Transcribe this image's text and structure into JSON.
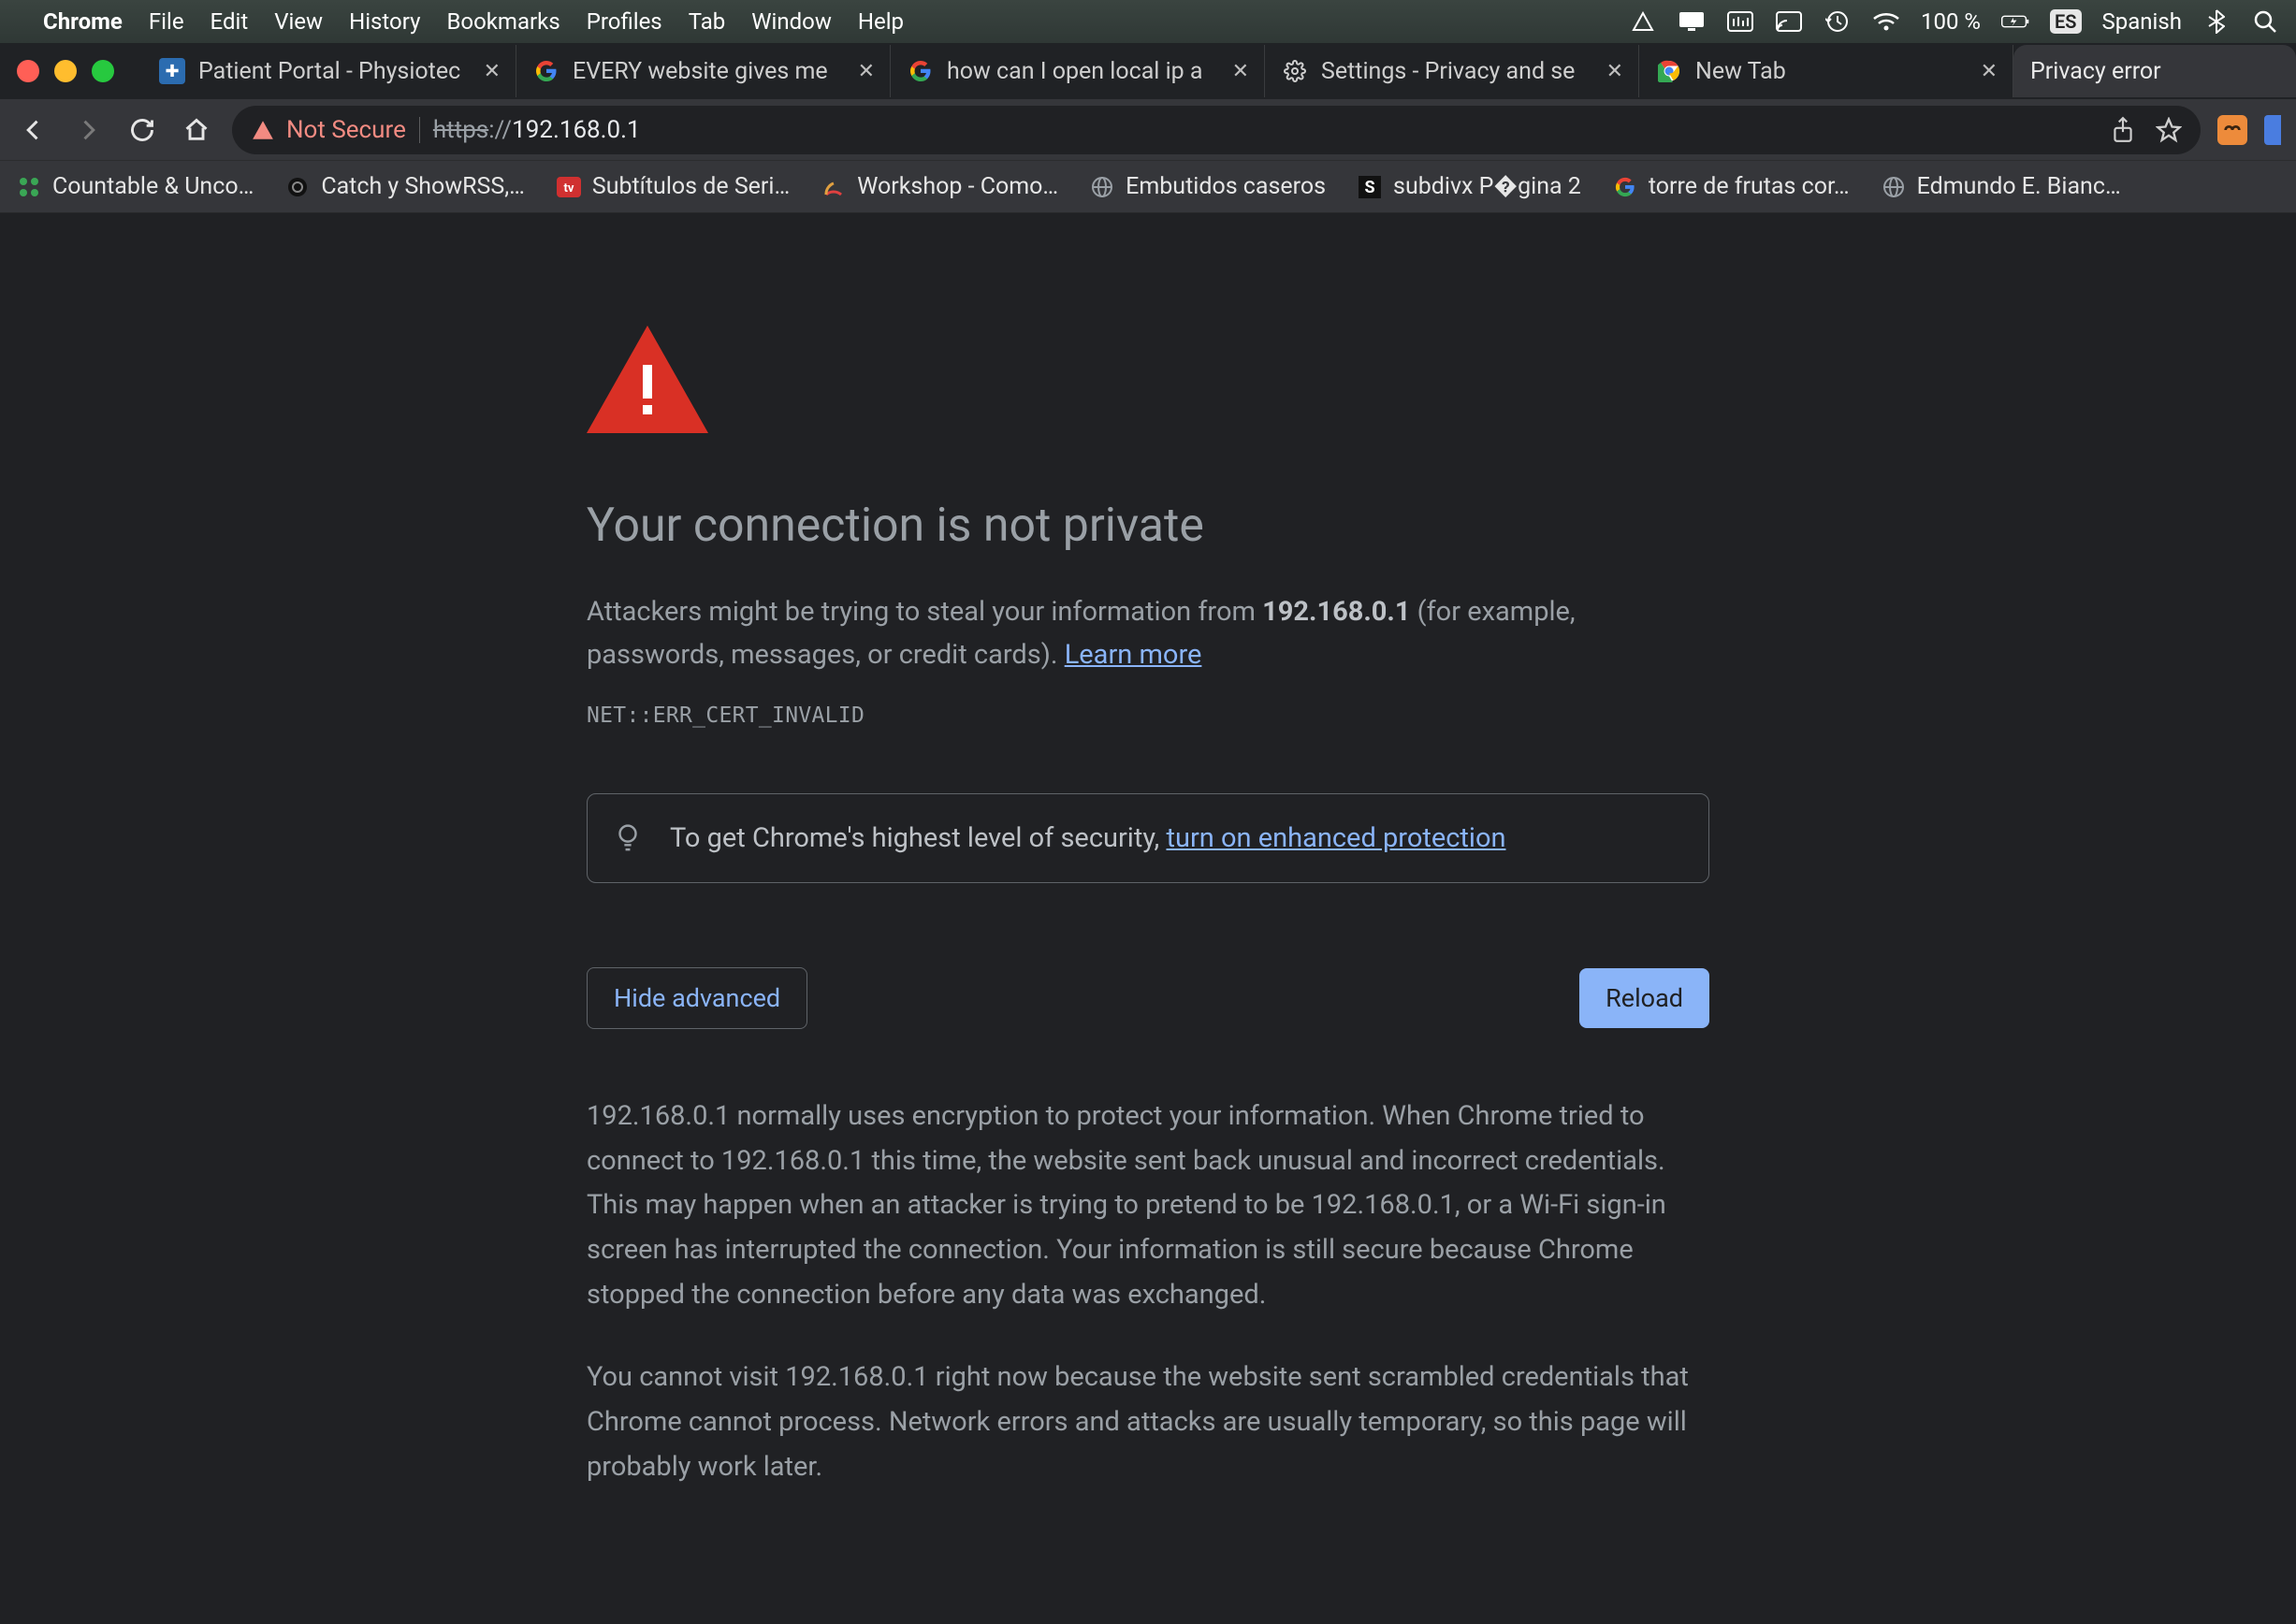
{
  "menubar": {
    "app": "Chrome",
    "items": [
      "File",
      "Edit",
      "View",
      "History",
      "Bookmarks",
      "Profiles",
      "Tab",
      "Window",
      "Help"
    ],
    "battery": "100 %",
    "lang_code": "ES",
    "lang_name": "Spanish"
  },
  "tabs": [
    {
      "title": "Patient Portal - Physiotec",
      "favicon": "physio"
    },
    {
      "title": "EVERY website gives me",
      "favicon": "google"
    },
    {
      "title": "how can I open local ip a",
      "favicon": "google"
    },
    {
      "title": "Settings - Privacy and se",
      "favicon": "gear"
    },
    {
      "title": "New Tab",
      "favicon": "chrome"
    },
    {
      "title": "Privacy error",
      "favicon": "none",
      "active": true
    }
  ],
  "omnibox": {
    "not_secure": "Not Secure",
    "scheme": "https",
    "colon": "://",
    "host": "192.168.0.1"
  },
  "bookmarks": [
    {
      "title": "Countable & Unco…",
      "icon": "green-grid"
    },
    {
      "title": "Catch y ShowRSS,…",
      "icon": "dark-circle"
    },
    {
      "title": "Subtítulos de Seri…",
      "icon": "red-box"
    },
    {
      "title": "Workshop - Como…",
      "icon": "arc"
    },
    {
      "title": "Embutidos caseros",
      "icon": "globe"
    },
    {
      "title": "subdivx P�gina 2",
      "icon": "s-box"
    },
    {
      "title": "torre de frutas cor…",
      "icon": "google"
    },
    {
      "title": "Edmundo E. Bianc…",
      "icon": "globe"
    }
  ],
  "page": {
    "title": "Your connection is not private",
    "body_prefix": "Attackers might be trying to steal your information from ",
    "body_host": "192.168.0.1",
    "body_suffix": " (for example, passwords, messages, or credit cards). ",
    "learn_more": "Learn more",
    "error_code": "NET::ERR_CERT_INVALID",
    "tip_prefix": "To get Chrome's highest level of security, ",
    "tip_link": "turn on enhanced protection",
    "btn_advanced": "Hide advanced",
    "btn_reload": "Reload",
    "details_p1": "192.168.0.1 normally uses encryption to protect your information. When Chrome tried to connect to 192.168.0.1 this time, the website sent back unusual and incorrect credentials. This may happen when an attacker is trying to pretend to be 192.168.0.1, or a Wi-Fi sign-in screen has interrupted the connection. Your information is still secure because Chrome stopped the connection before any data was exchanged.",
    "details_p2": "You cannot visit 192.168.0.1 right now because the website sent scrambled credentials that Chrome cannot process. Network errors and attacks are usually temporary, so this page will probably work later."
  }
}
